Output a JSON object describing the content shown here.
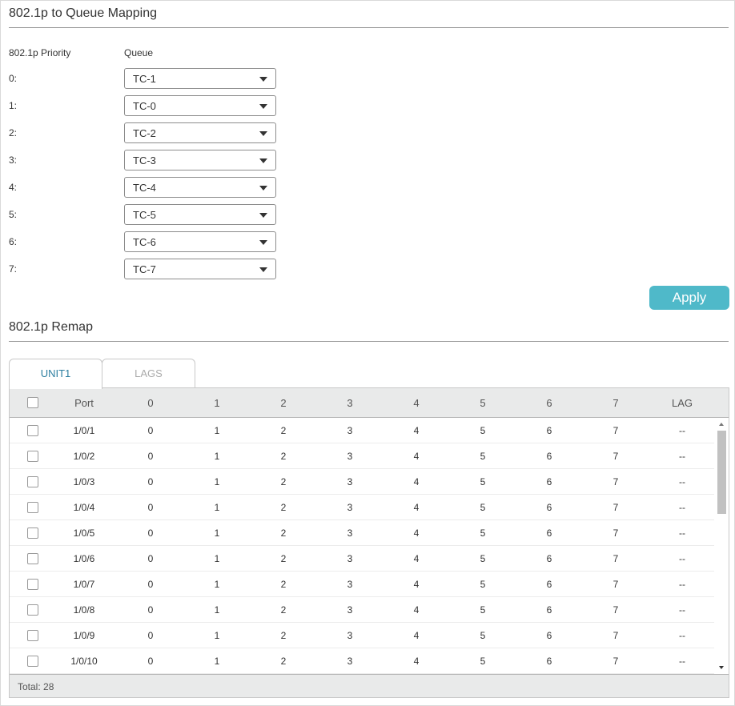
{
  "mapping": {
    "title": "802.1p to Queue Mapping",
    "col_priority": "802.1p Priority",
    "col_queue": "Queue",
    "rows": [
      {
        "priority": "0:",
        "queue": "TC-1"
      },
      {
        "priority": "1:",
        "queue": "TC-0"
      },
      {
        "priority": "2:",
        "queue": "TC-2"
      },
      {
        "priority": "3:",
        "queue": "TC-3"
      },
      {
        "priority": "4:",
        "queue": "TC-4"
      },
      {
        "priority": "5:",
        "queue": "TC-5"
      },
      {
        "priority": "6:",
        "queue": "TC-6"
      },
      {
        "priority": "7:",
        "queue": "TC-7"
      }
    ],
    "apply_label": "Apply"
  },
  "remap": {
    "title": "802.1p Remap",
    "tabs": [
      {
        "label": "UNIT1",
        "active": true
      },
      {
        "label": "LAGS",
        "active": false
      }
    ],
    "columns": [
      "Port",
      "0",
      "1",
      "2",
      "3",
      "4",
      "5",
      "6",
      "7",
      "LAG"
    ],
    "rows": [
      [
        "1/0/1",
        "0",
        "1",
        "2",
        "3",
        "4",
        "5",
        "6",
        "7",
        "--"
      ],
      [
        "1/0/2",
        "0",
        "1",
        "2",
        "3",
        "4",
        "5",
        "6",
        "7",
        "--"
      ],
      [
        "1/0/3",
        "0",
        "1",
        "2",
        "3",
        "4",
        "5",
        "6",
        "7",
        "--"
      ],
      [
        "1/0/4",
        "0",
        "1",
        "2",
        "3",
        "4",
        "5",
        "6",
        "7",
        "--"
      ],
      [
        "1/0/5",
        "0",
        "1",
        "2",
        "3",
        "4",
        "5",
        "6",
        "7",
        "--"
      ],
      [
        "1/0/6",
        "0",
        "1",
        "2",
        "3",
        "4",
        "5",
        "6",
        "7",
        "--"
      ],
      [
        "1/0/7",
        "0",
        "1",
        "2",
        "3",
        "4",
        "5",
        "6",
        "7",
        "--"
      ],
      [
        "1/0/8",
        "0",
        "1",
        "2",
        "3",
        "4",
        "5",
        "6",
        "7",
        "--"
      ],
      [
        "1/0/9",
        "0",
        "1",
        "2",
        "3",
        "4",
        "5",
        "6",
        "7",
        "--"
      ],
      [
        "1/0/10",
        "0",
        "1",
        "2",
        "3",
        "4",
        "5",
        "6",
        "7",
        "--"
      ]
    ],
    "total_label": "Total: 28"
  },
  "colors": {
    "accent": "#4fb9c9",
    "active_tab_text": "#2d7ea0",
    "header_bg": "#e9eaea"
  }
}
